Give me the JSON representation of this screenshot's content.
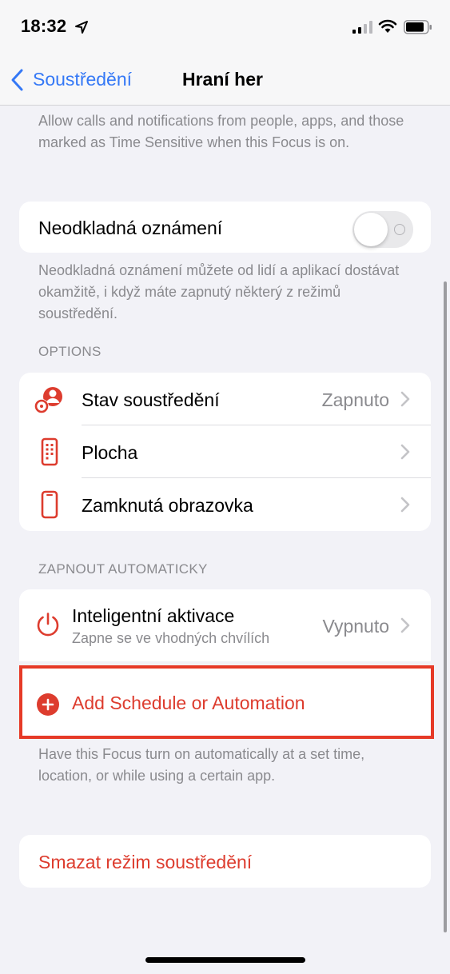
{
  "status_bar": {
    "time": "18:32",
    "icons": [
      "location-arrow-icon",
      "cellular-signal-icon",
      "wifi-icon",
      "battery-icon"
    ]
  },
  "nav": {
    "back_label": "Soustředění",
    "title": "Hraní her",
    "accent_color": "#3478f6"
  },
  "intro_footer": "Allow calls and notifications from people, apps, and those marked as Time Sensitive when this Focus is on.",
  "time_sensitive": {
    "label": "Neodkladná oznámení",
    "toggle_on": false,
    "footer": "Neodkladná oznámení můžete od lidí a aplikací dostávat okamžitě, i když máte zapnutý některý z režimů soustředění."
  },
  "options": {
    "header": "OPTIONS",
    "items": [
      {
        "icon": "focus-status-icon",
        "label": "Stav soustředění",
        "value": "Zapnuto"
      },
      {
        "icon": "home-screen-icon",
        "label": "Plocha",
        "value": ""
      },
      {
        "icon": "lock-screen-icon",
        "label": "Zamknutá obrazovka",
        "value": ""
      }
    ]
  },
  "auto": {
    "header": "ZAPNOUT AUTOMATICKY",
    "smart": {
      "icon": "power-icon",
      "label": "Inteligentní aktivace",
      "sublabel": "Zapne se ve vhodných chvílích",
      "value": "Vypnuto"
    },
    "add_label": "Add Schedule or Automation",
    "add_icon": "plus-circle-icon",
    "footer": "Have this Focus turn on automatically at a set time, location, or while using a certain app."
  },
  "delete_label": "Smazat režim soustředění",
  "colors": {
    "destructive": "#dd3c2e",
    "highlight_border": "#e63a27",
    "secondary_text": "#8a8a8e"
  }
}
